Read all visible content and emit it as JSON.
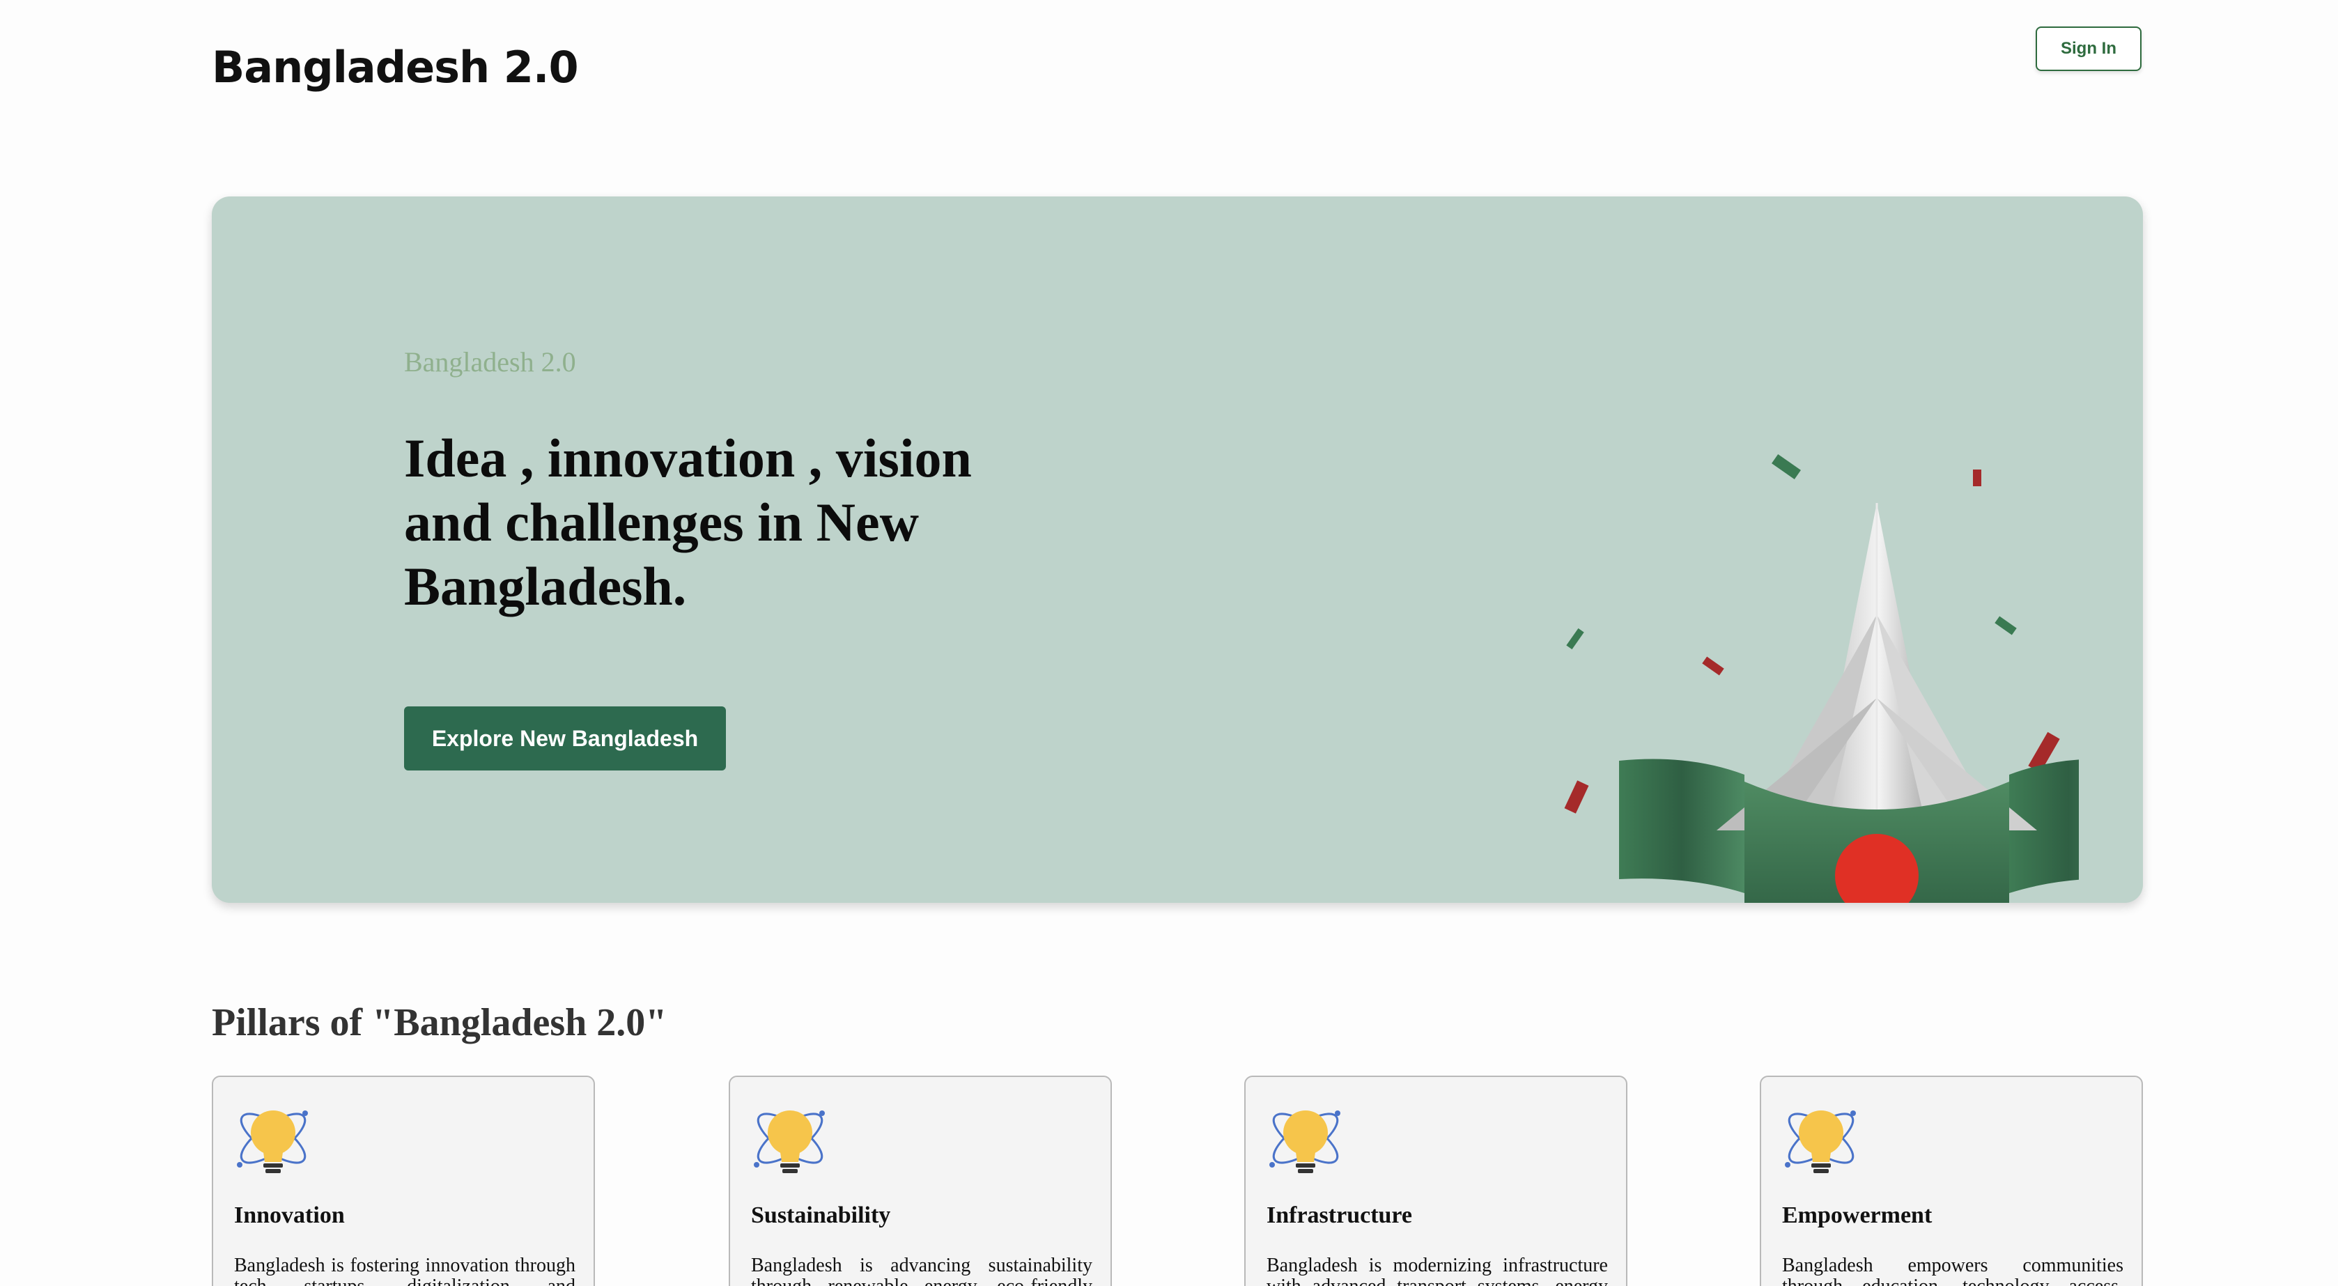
{
  "header": {
    "brand": "Bangladesh 2.0",
    "signin_label": "Sign In"
  },
  "hero": {
    "eyebrow": "Bangladesh 2.0",
    "title": "Idea , innovation , vision and challenges in New Bangladesh.",
    "cta_label": "Explore New Bangladesh"
  },
  "pillars": {
    "heading": "Pillars of \"Bangladesh 2.0\"",
    "items": [
      {
        "title": "Innovation",
        "desc": "Bangladesh is fostering innovation through tech startups, digitalization and"
      },
      {
        "title": "Sustainability",
        "desc": "Bangladesh is advancing sustainability through renewable energy, eco-friendly"
      },
      {
        "title": "Infrastructure",
        "desc": "Bangladesh is modernizing infrastructure with advanced transport systems, energy"
      },
      {
        "title": "Empowerment",
        "desc": "Bangladesh empowers communities through education, technology access,"
      }
    ]
  },
  "colors": {
    "accent_green": "#2d6a4f",
    "hero_bg": "#bed3cb",
    "flag_red": "#e03025"
  },
  "icons": {
    "card_icon": "lightbulb-atom-icon"
  }
}
